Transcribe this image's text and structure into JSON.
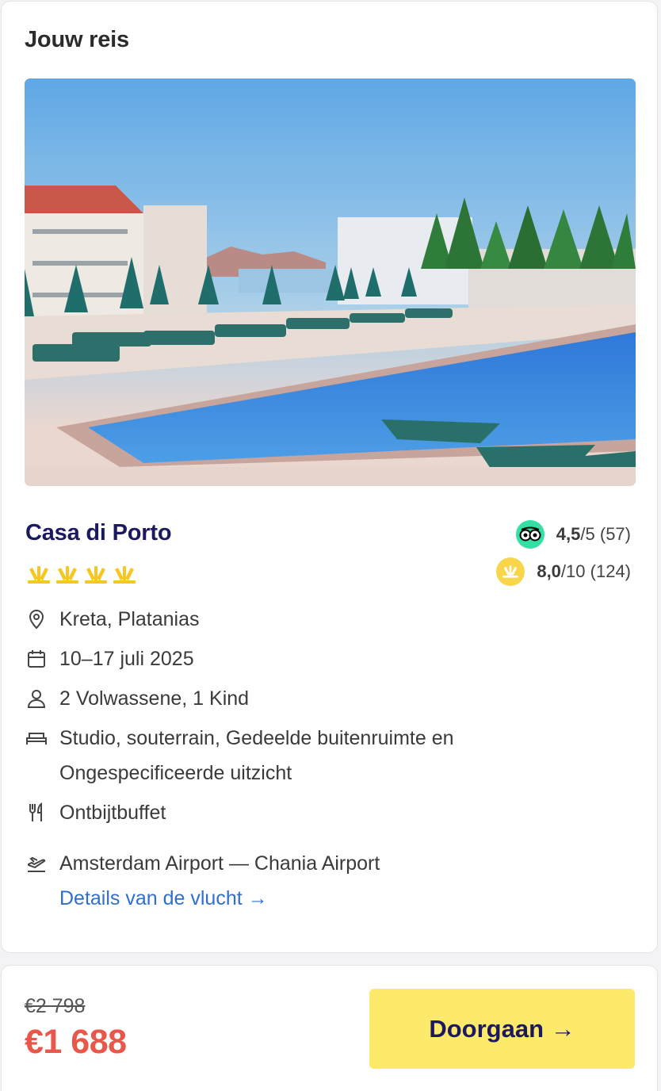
{
  "trip": {
    "section_title": "Jouw reis",
    "photo_alt": "Casa di Porto zwembad",
    "hotel_name": "Casa di Porto",
    "star_rating": 4,
    "ratings": {
      "tripadvisor": {
        "score": "4,5",
        "scale": "/5",
        "count": "(57)"
      },
      "sunweb": {
        "score": "8,0",
        "scale": "/10",
        "count": "(124)"
      }
    },
    "location": "Kreta, Platanias",
    "dates": "10–17 juli 2025",
    "travelers": "2 Volwassene, 1 Kind",
    "room_line1": "Studio, souterrain, Gedeelde buitenruimte en",
    "room_line2": "Ongespecificeerde uitzicht",
    "board": "Ontbijtbuffet",
    "flight": "Amsterdam Airport — Chania Airport",
    "flight_details_link": "Details van de vlucht →"
  },
  "footer": {
    "old_price": "€2 798",
    "new_price": "€1 688",
    "continue_button": "Doorgaan →"
  },
  "colors": {
    "brand_navy": "#1c1a5e",
    "price_red": "#e8574a",
    "cta_yellow": "#fde96a",
    "link_blue": "#2f6fd1",
    "star_yellow": "#f5c722"
  }
}
